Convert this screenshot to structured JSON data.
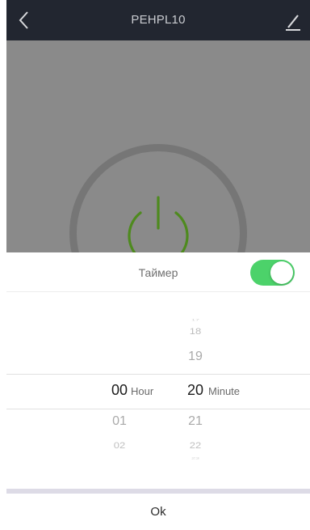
{
  "header": {
    "title": "PEHPL10",
    "back_icon": "chevron-left-icon",
    "edit_icon": "pencil-icon"
  },
  "device": {
    "power_icon": "power-icon",
    "power_color": "#4e8a1e"
  },
  "timer_sheet": {
    "title": "Таймер",
    "toggle_on": true,
    "toggle_color": "#4cd26a",
    "hour_picker": {
      "above": [
        "",
        ""
      ],
      "selected": "00",
      "below": [
        "01",
        "02"
      ],
      "unit": "Hour"
    },
    "minute_picker": {
      "above": [
        "17",
        "18",
        "19"
      ],
      "selected": "20",
      "below": [
        "21",
        "22",
        "23"
      ],
      "unit": "Minute"
    },
    "ok_label": "Ok"
  }
}
